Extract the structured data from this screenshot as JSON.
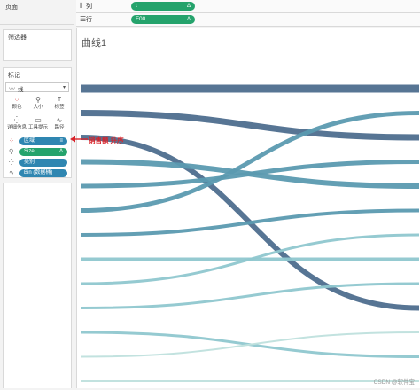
{
  "left_panel": {
    "pages_title": "页面",
    "filters_title": "筛选器",
    "marks_title": "标记",
    "mark_type": {
      "icon": "line-chart-icon",
      "label": "线"
    },
    "mark_buttons": [
      {
        "icon": "color-icon",
        "label": "颜色"
      },
      {
        "icon": "size-icon",
        "label": "大小"
      },
      {
        "icon": "label-icon",
        "label": "标签"
      },
      {
        "icon": "detail-icon",
        "label": "详细信息"
      },
      {
        "icon": "tooltip-icon",
        "label": "工具提示"
      },
      {
        "icon": "path-icon",
        "label": "路径"
      }
    ],
    "mark_pills": [
      {
        "icon": "color-dots-icon",
        "label": "区域",
        "end_icon": "sort-icon",
        "color": "#2f86b1"
      },
      {
        "icon": "size-icon",
        "label": "Size",
        "end_icon": "delta-icon",
        "color": "#25a36c"
      },
      {
        "icon": "detail-icon",
        "label": "类别",
        "end_icon": "",
        "color": "#2f86b1"
      },
      {
        "icon": "path-icon",
        "label": "Bin (数据桶)",
        "end_icon": "",
        "color": "#2f86b1"
      }
    ]
  },
  "shelves": {
    "columns": {
      "icon": "columns-icon",
      "label": "列",
      "pill": "t",
      "pill_icon": "delta-icon"
    },
    "rows": {
      "icon": "rows-icon",
      "label": "行",
      "pill": "F00",
      "pill_icon": "delta-icon"
    }
  },
  "sheet": {
    "title": "曲线1"
  },
  "annotation": {
    "text": "销售额 升序",
    "color": "#d8232a"
  },
  "watermark": "CSDN @软件宝",
  "colors": {
    "dark": "#4e6e8e",
    "mid": "#5b9ab0",
    "light": "#8fc7cf",
    "pale": "#bfe0dd",
    "pill_blue": "#2f86b1",
    "pill_green": "#25a36c"
  },
  "chart_data": {
    "type": "line",
    "description_type": "sigmoid-rank-curves",
    "series": [
      {
        "start_rank": 1,
        "end_rank": 1,
        "shade": "dark",
        "weight": 9
      },
      {
        "start_rank": 2,
        "end_rank": 3,
        "shade": "dark",
        "weight": 7
      },
      {
        "start_rank": 3,
        "end_rank": 10,
        "shade": "dark",
        "weight": 6
      },
      {
        "start_rank": 4,
        "end_rank": 5,
        "shade": "mid",
        "weight": 6
      },
      {
        "start_rank": 5,
        "end_rank": 4,
        "shade": "mid",
        "weight": 5
      },
      {
        "start_rank": 6,
        "end_rank": 2,
        "shade": "mid",
        "weight": 5
      },
      {
        "start_rank": 7,
        "end_rank": 6,
        "shade": "mid",
        "weight": 4
      },
      {
        "start_rank": 8,
        "end_rank": 8,
        "shade": "light",
        "weight": 4
      },
      {
        "start_rank": 9,
        "end_rank": 7,
        "shade": "light",
        "weight": 3
      },
      {
        "start_rank": 10,
        "end_rank": 9,
        "shade": "light",
        "weight": 3
      },
      {
        "start_rank": 11,
        "end_rank": 12,
        "shade": "light",
        "weight": 3
      },
      {
        "start_rank": 12,
        "end_rank": 11,
        "shade": "pale",
        "weight": 2
      },
      {
        "start_rank": 13,
        "end_rank": 13,
        "shade": "pale",
        "weight": 2
      }
    ]
  }
}
